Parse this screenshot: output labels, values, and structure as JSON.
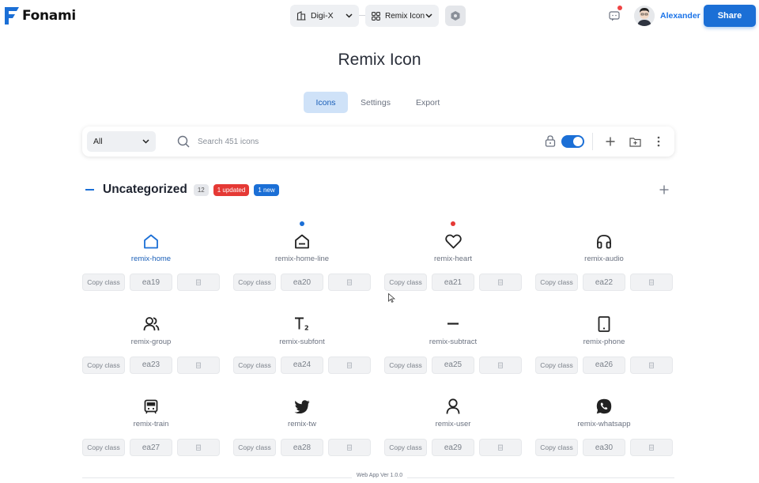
{
  "app": {
    "brand": "Fonami"
  },
  "header": {
    "project": "Digi-X",
    "iconset": "Remix Icon",
    "user_name": "Alexander",
    "share_label": "Share",
    "accent_color": "#1b6fd6"
  },
  "page": {
    "title": "Remix Icon"
  },
  "tabs": [
    {
      "label": "Icons",
      "active": true
    },
    {
      "label": "Settings",
      "active": false
    },
    {
      "label": "Export",
      "active": false
    }
  ],
  "toolbar": {
    "filter_value": "All",
    "search_placeholder": "Search 451 icons",
    "lock_toggle_on": true
  },
  "section": {
    "title": "Uncategorized",
    "count": "12",
    "updated_badge": "1 updated",
    "new_badge": "1 new"
  },
  "icons": [
    {
      "name": "remix-home",
      "code": "ea19",
      "icon": "home-icon",
      "status": "selected"
    },
    {
      "name": "remix-home-line",
      "code": "ea20",
      "icon": "home-line-icon",
      "status": "new"
    },
    {
      "name": "remix-heart",
      "code": "ea21",
      "icon": "heart-icon",
      "status": "updated"
    },
    {
      "name": "remix-audio",
      "code": "ea22",
      "icon": "headphones-icon",
      "status": ""
    },
    {
      "name": "remix-group",
      "code": "ea23",
      "icon": "group-icon",
      "status": ""
    },
    {
      "name": "remix-subfont",
      "code": "ea24",
      "icon": "subscript-icon",
      "status": ""
    },
    {
      "name": "remix-subtract",
      "code": "ea25",
      "icon": "subtract-icon",
      "status": ""
    },
    {
      "name": "remix-phone",
      "code": "ea26",
      "icon": "tablet-icon",
      "status": ""
    },
    {
      "name": "remix-train",
      "code": "ea27",
      "icon": "train-icon",
      "status": ""
    },
    {
      "name": "remix-tw",
      "code": "ea28",
      "icon": "twitter-icon",
      "status": ""
    },
    {
      "name": "remix-user",
      "code": "ea29",
      "icon": "user-icon",
      "status": ""
    },
    {
      "name": "remix-whatsapp",
      "code": "ea30",
      "icon": "whatsapp-icon",
      "status": ""
    }
  ],
  "card_labels": {
    "copy_class": "Copy class"
  },
  "status_colors": {
    "new": "#1b6fd6",
    "updated": "#e53935"
  },
  "footer": {
    "version": "Web App Ver 1.0.0"
  }
}
